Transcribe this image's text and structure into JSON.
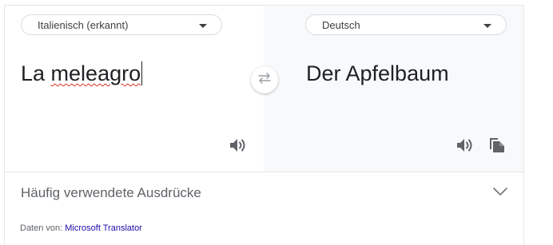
{
  "source": {
    "language_label": "Italienisch (erkannt)",
    "text_before": "La ",
    "text_misspelled": "meleagro"
  },
  "target": {
    "language_label": "Deutsch",
    "text": "Der Apfelbaum"
  },
  "icons": {
    "swap": "swap-arrows-icon",
    "speaker_source": "speaker-icon",
    "speaker_target": "speaker-icon",
    "copy": "copy-icon",
    "expand": "chevron-down-icon"
  },
  "phrases": {
    "label": "Häufig verwendete Ausdrücke"
  },
  "footer": {
    "prefix": "Daten von: ",
    "provider": "Microsoft Translator"
  },
  "colors": {
    "link": "#1a0dab",
    "muted": "#5f6368",
    "text": "#202124",
    "right_pane_bg": "#f8f9fa",
    "spellcheck": "#d93025"
  }
}
